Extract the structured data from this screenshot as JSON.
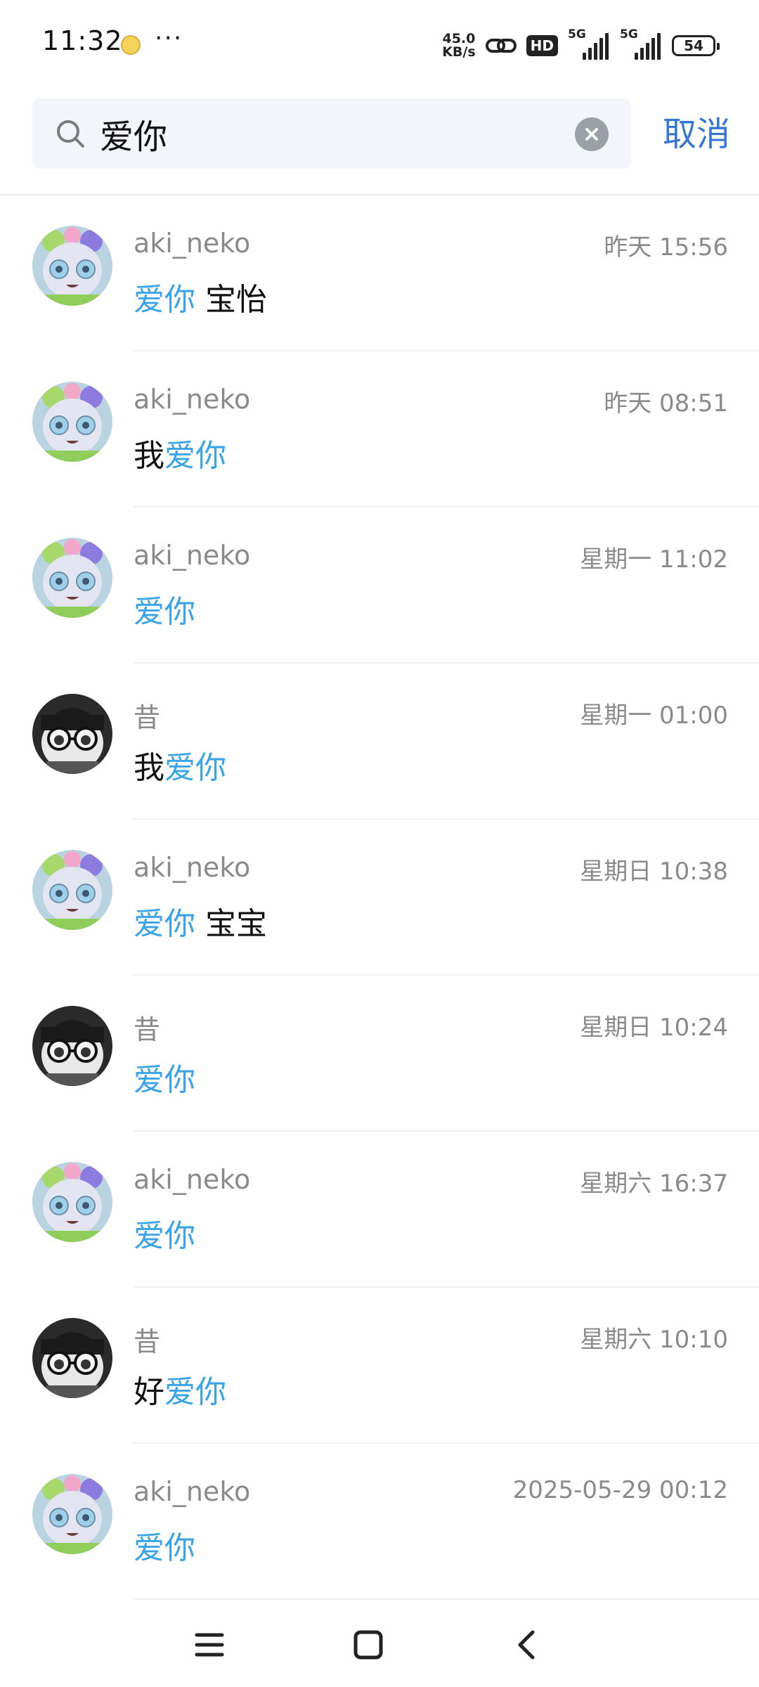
{
  "status_bar": {
    "time": "11:32",
    "more": "···",
    "net_speed_value": "45.0",
    "net_speed_unit": "KB/s",
    "hd_label": "HD",
    "network_1": "5G",
    "network_2": "5G",
    "battery": "54"
  },
  "search": {
    "query": "爱你",
    "cancel_label": "取消"
  },
  "colors": {
    "highlight": "#3aa4e8",
    "cancel": "#3576d6",
    "secondary_text": "#8a8a8a"
  },
  "results": [
    {
      "avatar": "aki_neko-avatar",
      "sender": "aki_neko",
      "time": "昨天 15:56",
      "pre": "",
      "match": "爱你",
      "post": " 宝怡"
    },
    {
      "avatar": "aki_neko-avatar",
      "sender": "aki_neko",
      "time": "昨天 08:51",
      "pre": "我",
      "match": "爱你",
      "post": ""
    },
    {
      "avatar": "aki_neko-avatar",
      "sender": "aki_neko",
      "time": "星期一 11:02",
      "pre": "",
      "match": "爱你",
      "post": ""
    },
    {
      "avatar": "xi-avatar",
      "sender": "昔",
      "time": "星期一 01:00",
      "pre": "我",
      "match": "爱你",
      "post": ""
    },
    {
      "avatar": "aki_neko-avatar",
      "sender": "aki_neko",
      "time": "星期日 10:38",
      "pre": "",
      "match": "爱你",
      "post": " 宝宝"
    },
    {
      "avatar": "xi-avatar",
      "sender": "昔",
      "time": "星期日 10:24",
      "pre": "",
      "match": "爱你",
      "post": ""
    },
    {
      "avatar": "aki_neko-avatar",
      "sender": "aki_neko",
      "time": "星期六 16:37",
      "pre": "",
      "match": "爱你",
      "post": ""
    },
    {
      "avatar": "xi-avatar",
      "sender": "昔",
      "time": "星期六 10:10",
      "pre": "好",
      "match": "爱你",
      "post": ""
    },
    {
      "avatar": "aki_neko-avatar",
      "sender": "aki_neko",
      "time": "2025-05-29 00:12",
      "pre": "",
      "match": "爱你",
      "post": ""
    }
  ],
  "nav_bar": {
    "menu_icon": "menu-icon",
    "home_icon": "home-icon",
    "back_icon": "back-icon"
  }
}
